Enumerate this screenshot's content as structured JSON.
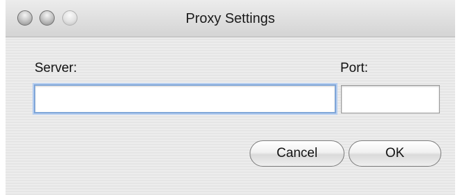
{
  "window": {
    "title": "Proxy Settings"
  },
  "traffic_lights": {
    "close_icon": "close-icon",
    "minimize_icon": "minimize-icon",
    "zoom_icon": "zoom-icon"
  },
  "form": {
    "server_label": "Server:",
    "server_value": "",
    "port_label": "Port:",
    "port_value": ""
  },
  "buttons": {
    "cancel_label": "Cancel",
    "ok_label": "OK"
  }
}
